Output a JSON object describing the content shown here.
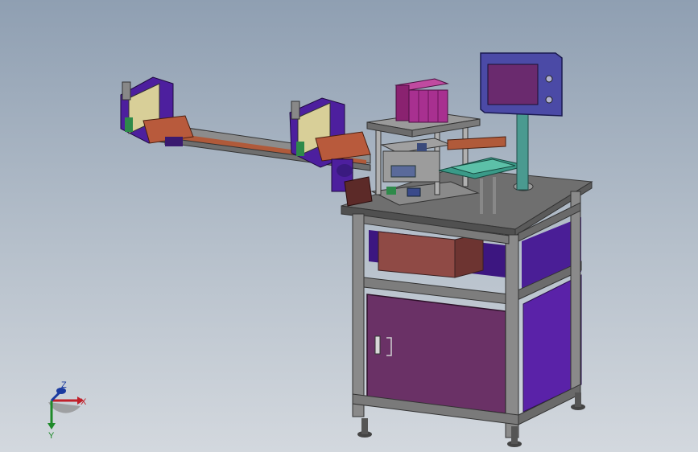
{
  "scene": {
    "background_top": "#8f9fb2",
    "background_bottom": "#d3d8de",
    "cabinet_color": "#6a3166",
    "frame_color": "#7a7a7a",
    "panel_color": "#4a1a8a",
    "hmi_color": "#4b4aa6",
    "motor_color": "#9c2a82"
  },
  "triad": {
    "x_label": "X",
    "y_label": "Y",
    "z_label": "Z",
    "x_color": "#c0202a",
    "y_color": "#1e8a2a",
    "z_color": "#1a3aa0"
  }
}
